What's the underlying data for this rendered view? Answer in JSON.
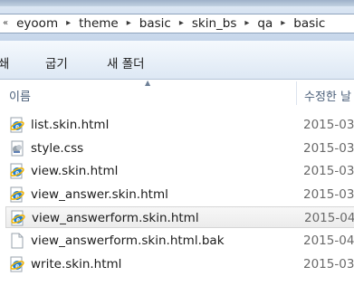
{
  "address_bar": {
    "partial_lead": "«",
    "crumbs": [
      "eyoom",
      "theme",
      "basic",
      "skin_bs",
      "qa",
      "basic"
    ],
    "separator": "▸"
  },
  "toolbar": {
    "partial_left": "쇄",
    "sort_label": "굽기",
    "new_folder_label": "새 폴더"
  },
  "columns": {
    "name": "이름",
    "date_modified_partial": "수정한 날"
  },
  "files": [
    {
      "name": "list.skin.html",
      "icon": "html-ie-icon",
      "date": "2015-03-"
    },
    {
      "name": "style.css",
      "icon": "css-file-icon",
      "date": "2015-03-"
    },
    {
      "name": "view.skin.html",
      "icon": "html-ie-icon",
      "date": "2015-03-"
    },
    {
      "name": "view_answer.skin.html",
      "icon": "html-ie-icon",
      "date": "2015-03-"
    },
    {
      "name": "view_answerform.skin.html",
      "icon": "html-ie-icon",
      "date": "2015-04-",
      "selected": true
    },
    {
      "name": "view_answerform.skin.html.bak",
      "icon": "blank-file-icon",
      "date": "2015-04-"
    },
    {
      "name": "write.skin.html",
      "icon": "html-ie-icon",
      "date": "2015-03-"
    }
  ],
  "colors": {
    "ie_blue": "#1c7fd6",
    "ie_ring": "#f2b400",
    "header_text": "#4c607a"
  }
}
